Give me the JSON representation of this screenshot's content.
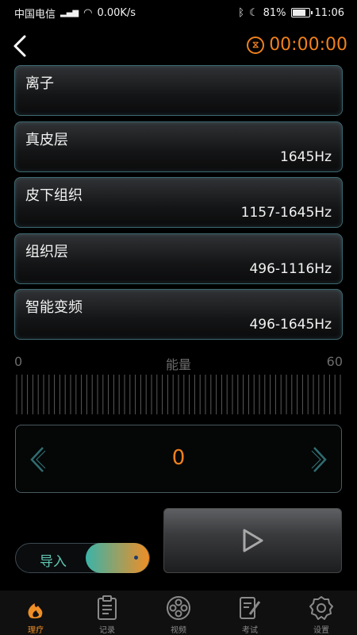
{
  "status_bar": {
    "carrier": "中国电信",
    "network": "⁴ᴳ",
    "speed": "0.00K/s",
    "battery": "81%",
    "battery_level": 0.81,
    "time": "11:06"
  },
  "header": {
    "timer": "00:00:00"
  },
  "modes": [
    {
      "name": "离子",
      "freq": ""
    },
    {
      "name": "真皮层",
      "freq": "1645Hz"
    },
    {
      "name": "皮下组织",
      "freq": "1157-1645Hz"
    },
    {
      "name": "组织层",
      "freq": "496-1116Hz"
    },
    {
      "name": "智能变频",
      "freq": "496-1645Hz"
    }
  ],
  "energy": {
    "min_label": "0",
    "title": "能量",
    "max_label": "60",
    "value": "0"
  },
  "import_toggle": {
    "label": "导入",
    "on": true
  },
  "nav": {
    "items": [
      {
        "label": "理疗",
        "icon": "flame-icon",
        "active": true
      },
      {
        "label": "记录",
        "icon": "clipboard-icon",
        "active": false
      },
      {
        "label": "视频",
        "icon": "film-reel-icon",
        "active": false
      },
      {
        "label": "考试",
        "icon": "exam-pen-icon",
        "active": false
      },
      {
        "label": "设置",
        "icon": "gear-icon",
        "active": false
      }
    ]
  },
  "colors": {
    "accent": "#f0801c",
    "teal": "#3bb3a8",
    "card_border": "#3c6870"
  }
}
